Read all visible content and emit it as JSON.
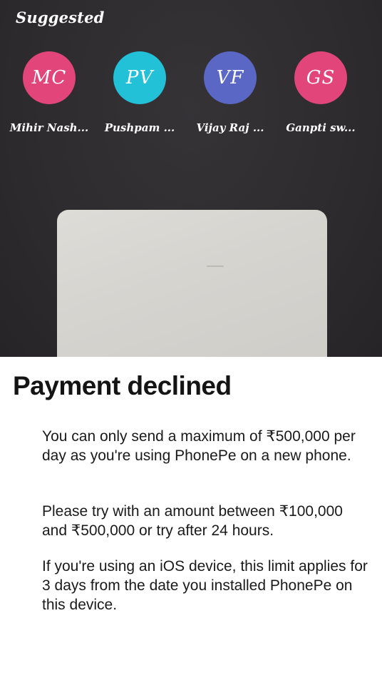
{
  "suggested": {
    "title": "Suggested",
    "contacts": [
      {
        "initials": "MC",
        "name": "Mihir Nash...",
        "color": "#e2457a"
      },
      {
        "initials": "PV",
        "name": "Pushpam ...",
        "color": "#22c1d8"
      },
      {
        "initials": "VF",
        "name": "Vijay Raj ...",
        "color": "#5b67c4"
      },
      {
        "initials": "GS",
        "name": "Ganpti sw...",
        "color": "#e2457a"
      }
    ]
  },
  "dialog": {
    "title": "Payment declined",
    "paragraphs": [
      "You can only send a maximum of ₹500,000 per day as you're using PhonePe on a new phone.",
      "Please try with an amount between ₹100,000 and ₹500,000  or try after 24 hours.",
      "If you're using an iOS device, this limit applies for 3 days from the date you installed PhonePe on this device."
    ]
  }
}
